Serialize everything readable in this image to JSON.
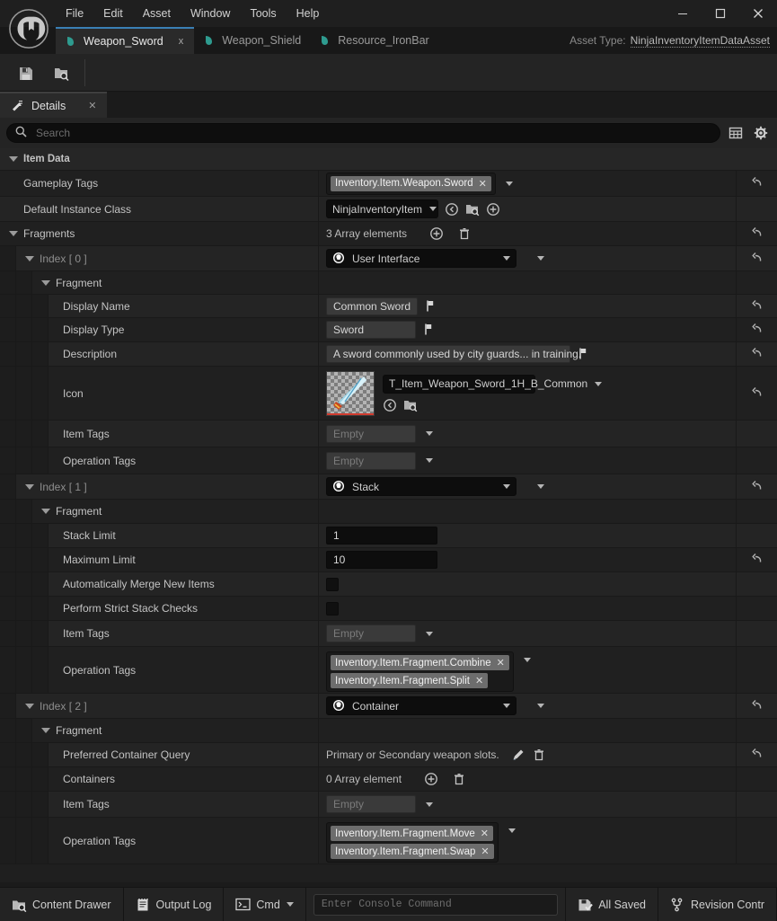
{
  "window": {
    "menu": [
      "File",
      "Edit",
      "Asset",
      "Window",
      "Tools",
      "Help"
    ],
    "minimize": "─",
    "maximize": "☐",
    "close": "✕"
  },
  "tabs": [
    {
      "label": "Weapon_Sword",
      "active": true,
      "close": "x"
    },
    {
      "label": "Weapon_Shield",
      "active": false
    },
    {
      "label": "Resource_IronBar",
      "active": false
    }
  ],
  "asset_type": {
    "label": "Asset Type:",
    "value": "NinjaInventoryItemDataAsset"
  },
  "toolbar": {
    "save_name": "save-icon",
    "browse_name": "browse-content-icon"
  },
  "details_panel": {
    "title": "Details",
    "close": "✕"
  },
  "search": {
    "placeholder": "Search",
    "grid_icon": "grid-view-icon",
    "settings_icon": "gear-icon"
  },
  "tree": {
    "item_data": "Item Data",
    "rows": {
      "gameplay_tags": {
        "label": "Gameplay Tags",
        "tag": "Inventory.Item.Weapon.Sword"
      },
      "default_instance_class": {
        "label": "Default Instance Class",
        "value": "NinjaInventoryItem"
      },
      "fragments": {
        "label": "Fragments",
        "count": "3 Array elements"
      },
      "index0": {
        "label": "Index [ 0 ]",
        "value": "User Interface"
      },
      "fragment": {
        "label": "Fragment"
      },
      "display_name": {
        "label": "Display Name",
        "value": "Common Sword"
      },
      "display_type": {
        "label": "Display Type",
        "value": "Sword"
      },
      "description": {
        "label": "Description",
        "value": "A sword commonly used by city guards... in training."
      },
      "icon": {
        "label": "Icon",
        "value": "T_Item_Weapon_Sword_1H_B_Common"
      },
      "item_tags_0": {
        "label": "Item Tags",
        "value": "Empty"
      },
      "operation_tags_0": {
        "label": "Operation Tags",
        "value": "Empty"
      },
      "index1": {
        "label": "Index [ 1 ]",
        "value": "Stack"
      },
      "stack_limit": {
        "label": "Stack Limit",
        "value": "1"
      },
      "maximum_limit": {
        "label": "Maximum Limit",
        "value": "10"
      },
      "auto_merge": {
        "label": "Automatically Merge New Items",
        "checked": false
      },
      "strict_stack": {
        "label": "Perform Strict Stack Checks",
        "checked": false
      },
      "item_tags_1": {
        "label": "Item Tags",
        "value": "Empty"
      },
      "operation_tags_1": {
        "label": "Operation Tags",
        "tags": [
          "Inventory.Item.Fragment.Combine",
          "Inventory.Item.Fragment.Split"
        ]
      },
      "index2": {
        "label": "Index [ 2 ]",
        "value": "Container"
      },
      "preferred_container_query": {
        "label": "Preferred Container Query",
        "value": "Primary or Secondary weapon slots."
      },
      "containers": {
        "label": "Containers",
        "count": "0 Array element"
      },
      "item_tags_2": {
        "label": "Item Tags",
        "value": "Empty"
      },
      "operation_tags_2": {
        "label": "Operation Tags",
        "tags": [
          "Inventory.Item.Fragment.Move",
          "Inventory.Item.Fragment.Swap"
        ]
      }
    }
  },
  "status_bar": {
    "content_drawer": "Content Drawer",
    "output_log": "Output Log",
    "cmd": "Cmd",
    "console_placeholder": "Enter Console Command",
    "all_saved": "All Saved",
    "revision_control": "Revision Contr"
  },
  "colors": {
    "accent_tab": "#3a7fb5",
    "panel_bg": "#1f1f1f",
    "row_alt": "#242424",
    "tag_chip": "#6d6d6d",
    "thumb_red": "#d13b2e"
  }
}
